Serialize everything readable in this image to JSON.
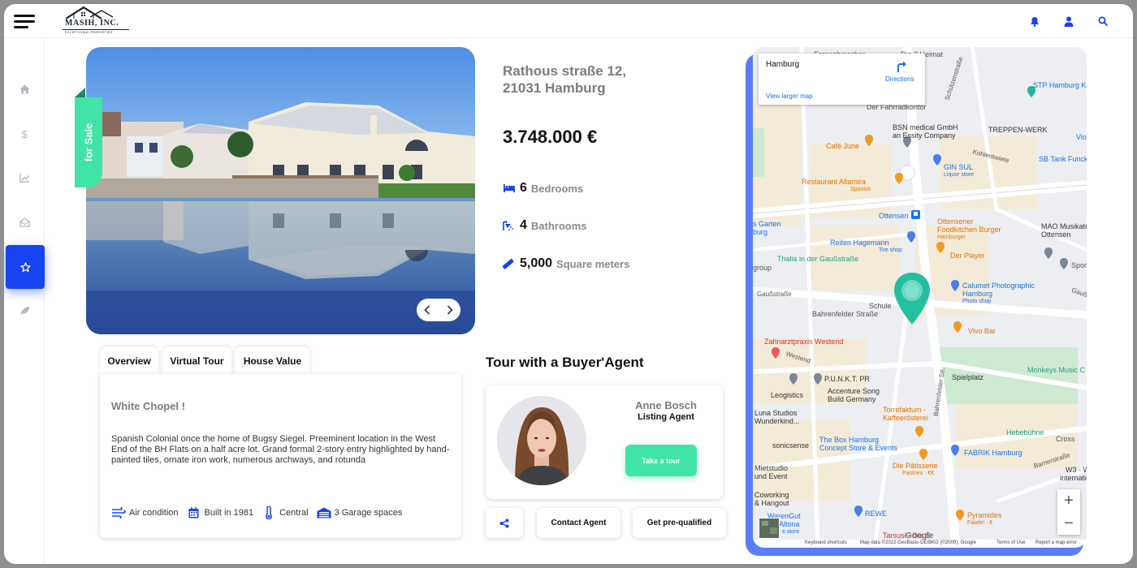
{
  "header": {
    "logo_name": "MASIH, INC.",
    "logo_tagline": "EXCEPTIONAL PROPERTIES",
    "icons": [
      "menu-icon",
      "bell-icon",
      "user-icon",
      "search-icon"
    ]
  },
  "sidebar": {
    "items": [
      {
        "name": "home",
        "icon": "home-icon"
      },
      {
        "name": "pricing",
        "icon": "dollar-icon"
      },
      {
        "name": "analytics",
        "icon": "chart-icon"
      },
      {
        "name": "inbox",
        "icon": "inbox-icon"
      },
      {
        "name": "favorites",
        "icon": "star-icon",
        "active": true
      },
      {
        "name": "eco",
        "icon": "leaf-icon"
      }
    ]
  },
  "listing": {
    "badge": "for Sale",
    "address_line1": "Rathous straße 12,",
    "address_line2": "21031 Hamburg",
    "price": "3.748.000 €",
    "features": [
      {
        "icon": "bed-icon",
        "value": "6",
        "label": "Bedrooms"
      },
      {
        "icon": "shower-icon",
        "value": "4",
        "label": "Bathrooms"
      },
      {
        "icon": "ruler-icon",
        "value": "5,000",
        "label": "Square meters"
      }
    ]
  },
  "tabs": [
    "Overview",
    "Virtual Tour",
    "House Value"
  ],
  "overview": {
    "title": "White Chopel !",
    "body": "Spanish Colonial once the home of Bugsy Siegel. Preeminent location in the West End of the BH Flats on a half acre lot. Grand formal 2-story entry highlighted by hand-painted tiles, ornate iron work, numerous archways, and rotunda",
    "amenities": [
      {
        "icon": "wind-icon",
        "label": "Air condition"
      },
      {
        "icon": "calendar-icon",
        "label": "Built in 1981"
      },
      {
        "icon": "thermometer-icon",
        "label": "Central"
      },
      {
        "icon": "garage-icon",
        "label": "3 Garage spaces"
      }
    ]
  },
  "tour": {
    "title": "Tour with a Buyer'Agent",
    "agent_name": "Anne Bosch",
    "agent_role": "Listing Agent",
    "tour_button": "Take a tour",
    "contact_button": "Contact Agent",
    "prequalified_button": "Get pre-qualified"
  },
  "map": {
    "info_city": "Hamburg",
    "directions": "Directions",
    "larger_map": "View larger map",
    "zoom_in": "+",
    "zoom_out": "−",
    "attribution": {
      "shortcuts": "Keyboard shortcuts",
      "data": "Map data ©2022 GeoBasis-DE/BKG (©2009), Google",
      "terms": "Terms of Use",
      "report": "Report a map error",
      "brand": "Google"
    },
    "labels": {
      "fernsehmacher": "Fernsehmacher",
      "zur_heimat": "Die 3 Heimat",
      "schuetzenstrasse": "Schützenstraße",
      "stp": "STP Hamburg Konz",
      "fahrradkontor": "Der Fahrradkontor",
      "bsn": "BSN medical GmbH",
      "bsn_sub": "an Essity Company",
      "treppen": "TREPPEN-WERK",
      "vio": "Vio",
      "cafe_june": "Café June",
      "kohlentwiete": "Kohlentwiete",
      "sb_tank": "SB Tank Funck",
      "gin_sul": "GIN SUL",
      "gin_sul_sub": "Liquor store",
      "altamira": "Restaurant Altamira",
      "altamira_sub": "Spanish",
      "ottensen": "Ottensen",
      "ottensener": "Ottensener",
      "foodkitchen": "Foodkitchen Burger",
      "foodkitchen_sub": "Hamburger",
      "mao": "MAO Musikatel",
      "mao2": "Ottensen",
      "garten": "s Garten",
      "burg": "burg",
      "reifen": "Reifen Hagemann",
      "reifen_sub": "Tire shop",
      "derplayer": "Der Player",
      "thalia": "Thalia in der Gaußstraße",
      "spor": "Spor",
      "group": "group",
      "calumet": "Calumet Photographic",
      "calumet2": "Hamburg",
      "calumet_sub": "Photo shop",
      "gausstrasse": "Gaußstraße",
      "gauss2": "Gauß",
      "schule": "Schule",
      "bahrenfelder": "Bahrenfelder Straße",
      "vivo": "Vivo Bar",
      "zahnarzt": "Zahnarztpraxis Westend",
      "westend": "Westend",
      "punkt": "P.U.N.K.T. PR",
      "monkeys": "Monkeys Music C",
      "leogistics": "Leogistics",
      "accenture": "Accenture Song",
      "accenture2": "Build Germany",
      "spielplatz": "Spielplatz",
      "bahrenfelder_str": "Bahrenfelder Str.",
      "luna": "Luna Studios",
      "wunderkind": "Wunderkind...",
      "torrefaktum": "Torrefaktum -",
      "kaffeeroesterei": "Kaffeerösterei",
      "hebebuehne": "Hebebühne",
      "cross": "Cross",
      "sonicsense": "sonicsense",
      "boxhamburg": "The Box Hamburg",
      "boxhamburg2": "Concept Store & Events",
      "fabrik": "FABRIK Hamburg",
      "barnerstrasse": "Barnerstraße",
      "mietstudio": "Mietstudio",
      "undevent": "und Event",
      "pattisserie": "Die Pâtisserie",
      "pattisserie_sub": "Pastries · €€",
      "w3": "W3 - W",
      "international": "internation",
      "coworking": "Coworking",
      "hangout": "& Hangout",
      "warengut": "WarenGut",
      "altona": "Altona",
      "altona_sub": "e store",
      "rewe": "REWE",
      "pyramides": "Pyramides",
      "pyramides_sub": "Falafel · €",
      "tarsusi": "Tarsusi - Die S"
    }
  }
}
